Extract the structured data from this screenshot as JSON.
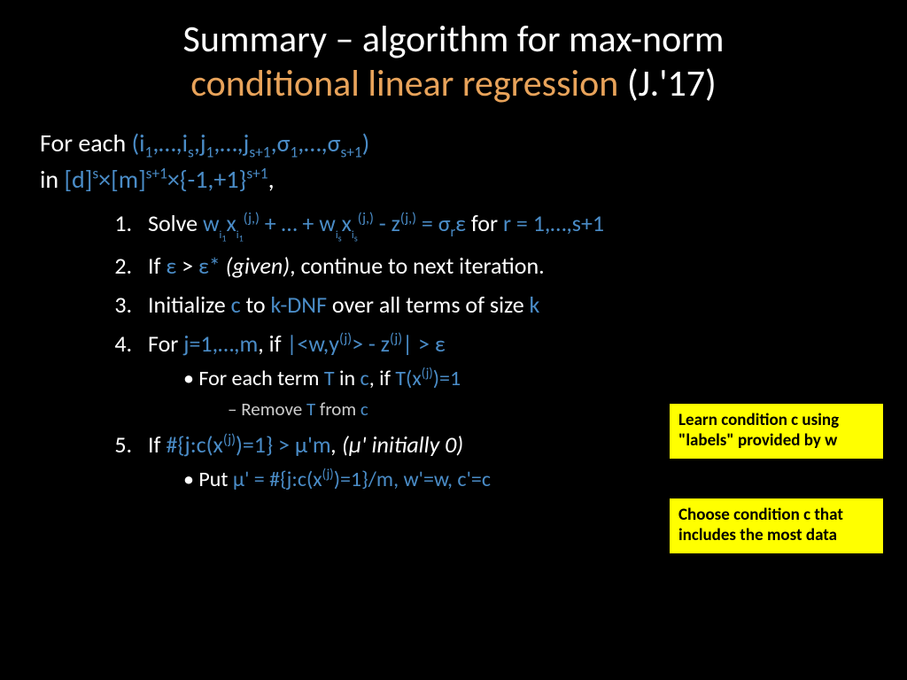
{
  "title": {
    "line1": "Summary – algorithm for max-norm",
    "highlight": "conditional linear regression",
    "suffix": " (J.'17)"
  },
  "intro": {
    "prefix": "For each ",
    "tuple_open": "(i",
    "tuple_body": ",…,i",
    "tuple_j": ",j",
    "tuple_j2": ",…,j",
    "tuple_sigma": ",σ",
    "tuple_sigma2": ",…,σ",
    "tuple_close": ")",
    "in": "in ",
    "domain1": "[d]",
    "times1": "×",
    "domain2": "[m]",
    "times2": "×",
    "domain3": "{-1,+1}",
    "comma": ","
  },
  "steps": {
    "s1_a": "Solve ",
    "s1_w": "w",
    "s1_x": "x",
    "s1_plus": " + … + ",
    "s1_minus": " - ",
    "s1_z": "z",
    "s1_eq": " = ",
    "s1_sigma": "σ",
    "s1_r": "r",
    "s1_eps": "ε",
    "s1_for": " for ",
    "s1_range": "r = 1,…,s+1",
    "s2_a": "If ",
    "s2_eps": "ε",
    "s2_gt": " > ",
    "s2_epsstar": "ε*",
    "s2_given": " (given)",
    "s2_cont": ", continue to next iteration.",
    "s3_a": "Initialize ",
    "s3_c": "c",
    "s3_to": " to ",
    "s3_kdnf": "k-DNF",
    "s3_over": " over all terms of size ",
    "s3_k": "k",
    "s4_a": "For ",
    "s4_range": "j=1,…,m",
    "s4_if": ", if ",
    "s4_expr1": "|<w,y",
    "s4_expr2": "> - z",
    "s4_expr3": "| > ",
    "s4_eps": "ε",
    "s4b_a": "For each term ",
    "s4b_T": "T",
    "s4b_in": " in ",
    "s4b_c": "c",
    "s4b_if": ", if ",
    "s4b_Tx": "T(x",
    "s4b_eq": ")=1",
    "s4c_a": "Remove ",
    "s4c_T": "T",
    "s4c_from": " from ",
    "s4c_c": "c",
    "s5_a": "If ",
    "s5_expr": "#{j:c(x",
    "s5_expr2": ")=1} > ",
    "s5_mu": "μ'm",
    "s5_init": ", (μ' initially 0)",
    "s5b_a": "Put ",
    "s5b_mu": "μ' = #{j:c(x",
    "s5b_expr": ")=1}/m",
    "s5b_w": ", w'=w",
    "s5b_c": ", c'=c"
  },
  "callouts": {
    "c1": "Learn condition c using \"labels\" provided by w",
    "c2": "Choose condition c that includes the most data"
  },
  "sub": {
    "one": "1",
    "s": "s",
    "sp1": "s+1",
    "i1": "i",
    "i1s": "1",
    "is": "i",
    "iss": "s",
    "jr": "(j,)",
    "j": "(j)",
    "r": "r"
  }
}
